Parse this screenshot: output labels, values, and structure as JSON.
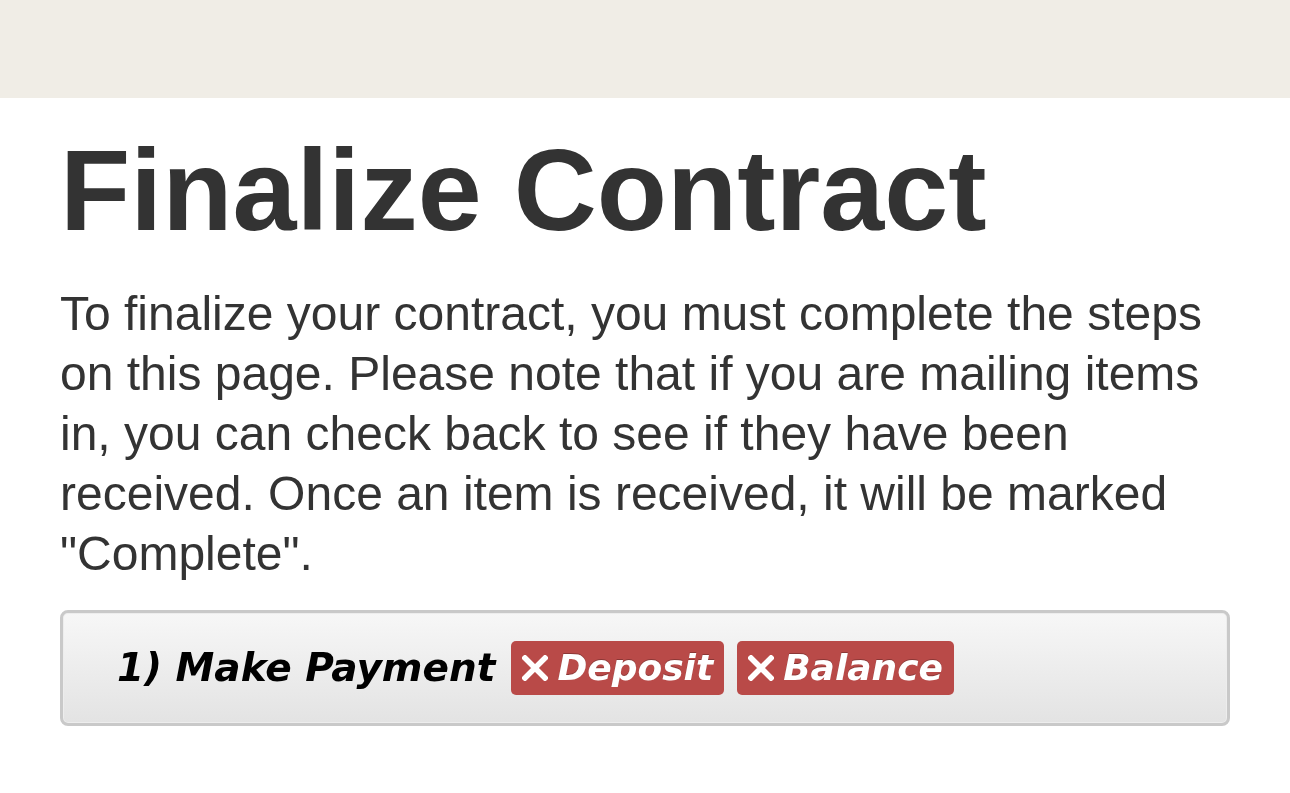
{
  "page": {
    "title": "Finalize Contract",
    "intro": "To finalize your contract, you must complete the steps on this page. Please note that if you are mailing items in, you can check back to see if they have been received. Once an item is received, it will be marked \"Complete\"."
  },
  "steps": [
    {
      "title": "1) Make Payment",
      "badges": [
        {
          "label": "Deposit",
          "complete": false
        },
        {
          "label": "Balance",
          "complete": false
        }
      ]
    }
  ]
}
